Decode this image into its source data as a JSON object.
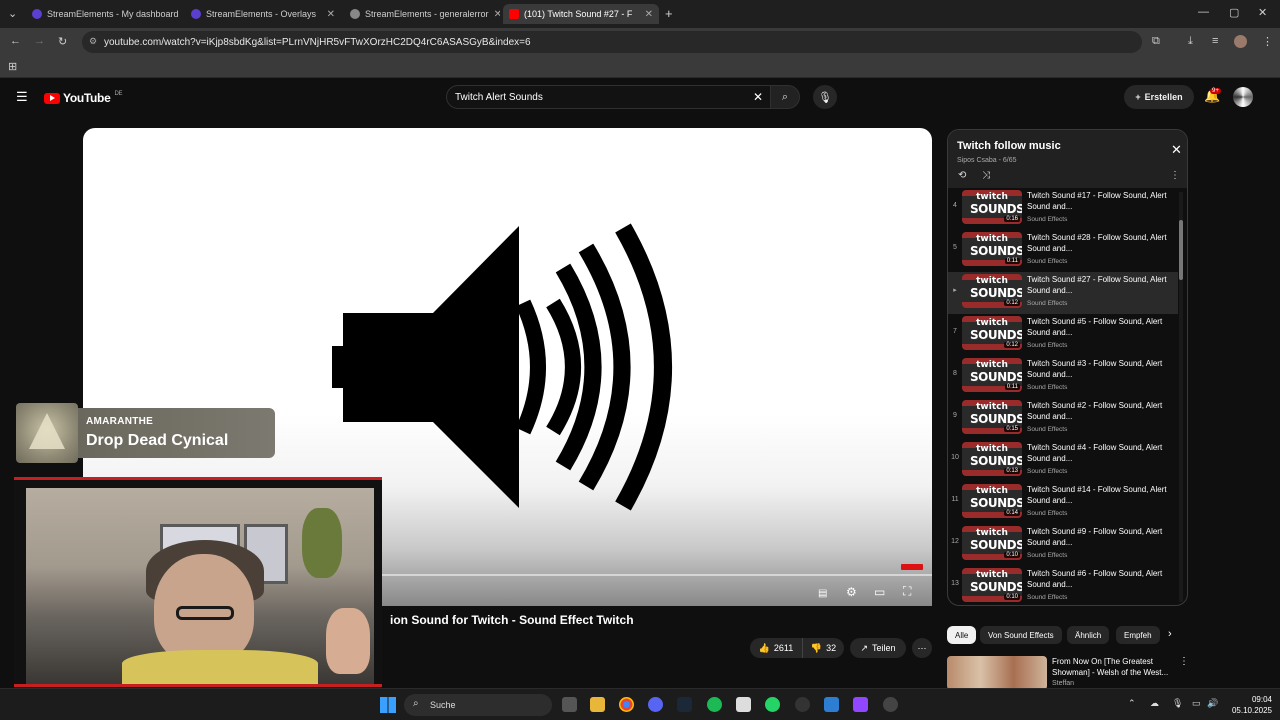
{
  "browser": {
    "tabs": [
      {
        "label": "StreamElements - My dashboard",
        "active": false
      },
      {
        "label": "StreamElements - Overlays",
        "active": false
      },
      {
        "label": "StreamElements - generalerror",
        "active": false
      },
      {
        "label": "(101) Twitch Sound #27 - F",
        "active": true
      }
    ],
    "url": "youtube.com/watch?v=iKjp8sbdKg&list=PLrnVNjHR5vFTwXOrzHC2DQ4rC6ASASGyB&index=6"
  },
  "youtube": {
    "logo": "YouTube",
    "region": "DE",
    "search_value": "Twitch Alert Sounds",
    "create_label": "Erstellen",
    "notif_count": "9+"
  },
  "video": {
    "title": "ion Sound for Twitch - Sound Effect Twitch",
    "likes": "2611",
    "dislikes": "32",
    "share_label": "Teilen"
  },
  "overlay": {
    "artist": "AMARANTHE",
    "song": "Drop Dead Cynical"
  },
  "playlist": {
    "title": "Twitch follow music",
    "subtitle": "Sipos Csaba - 6/65",
    "thumb_line1": "twitch",
    "thumb_line2": "SOUNDS",
    "items": [
      {
        "num": "4",
        "title": "Twitch Sound #17 - Follow Sound, Alert Sound and...",
        "channel": "Sound Effects",
        "duration": "0:16"
      },
      {
        "num": "5",
        "title": "Twitch Sound #28 - Follow Sound, Alert Sound and...",
        "channel": "Sound Effects",
        "duration": "0:11"
      },
      {
        "num": "▸",
        "title": "Twitch Sound #27 - Follow Sound, Alert Sound and...",
        "channel": "Sound Effects",
        "duration": "0:12"
      },
      {
        "num": "7",
        "title": "Twitch Sound #5 - Follow Sound, Alert Sound and...",
        "channel": "Sound Effects",
        "duration": "0:12"
      },
      {
        "num": "8",
        "title": "Twitch Sound #3 - Follow Sound, Alert Sound and...",
        "channel": "Sound Effects",
        "duration": "0:11"
      },
      {
        "num": "9",
        "title": "Twitch Sound #2 - Follow Sound, Alert Sound and...",
        "channel": "Sound Effects",
        "duration": "0:15"
      },
      {
        "num": "10",
        "title": "Twitch Sound #4 - Follow Sound, Alert Sound and...",
        "channel": "Sound Effects",
        "duration": "0:13"
      },
      {
        "num": "11",
        "title": "Twitch Sound #14 - Follow Sound, Alert Sound and...",
        "channel": "Sound Effects",
        "duration": "0:14"
      },
      {
        "num": "12",
        "title": "Twitch Sound #9 - Follow Sound, Alert Sound and...",
        "channel": "Sound Effects",
        "duration": "0:10"
      },
      {
        "num": "13",
        "title": "Twitch Sound #6 - Follow Sound, Alert Sound and...",
        "channel": "Sound Effects",
        "duration": "0:10"
      }
    ]
  },
  "chips": [
    "Alle",
    "Von Sound Effects",
    "Ähnlich",
    "Empfeh"
  ],
  "recommendation": {
    "title": "From Now On [The Greatest Showman] - Welsh of the West...",
    "channel": "Steffan"
  },
  "taskbar": {
    "search_placeholder": "Suche",
    "time": "09:04",
    "date": "05.10.2025"
  }
}
